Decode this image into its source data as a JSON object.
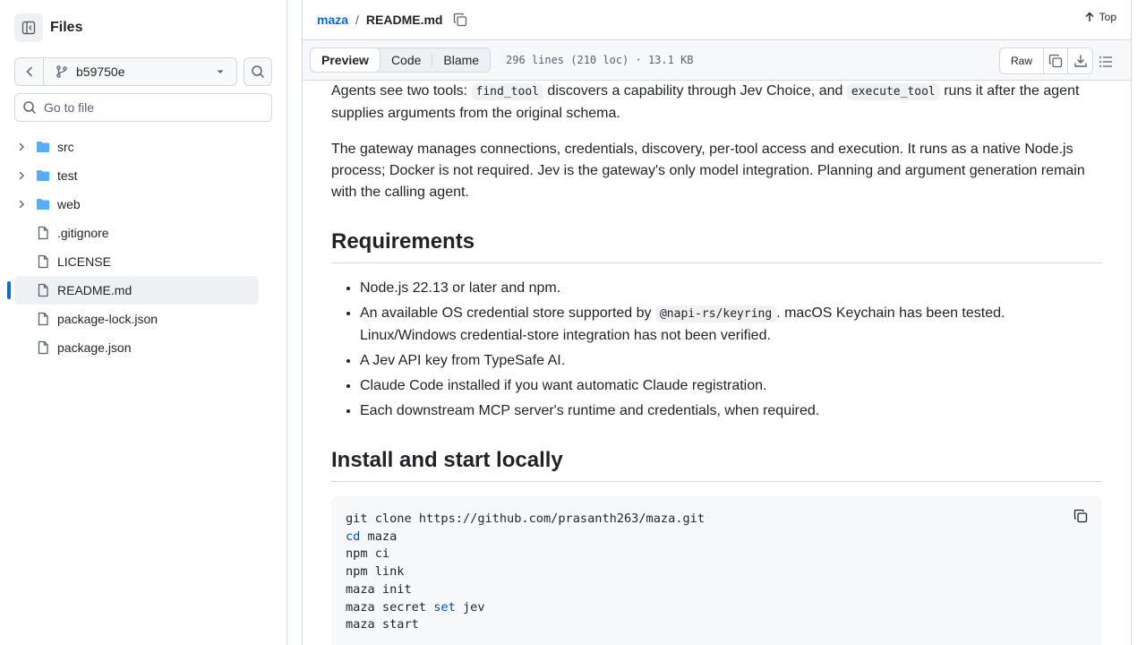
{
  "sidebar": {
    "title": "Files",
    "branch": "b59750e",
    "goto_placeholder": "Go to file",
    "items": [
      {
        "label": "src",
        "type": "folder"
      },
      {
        "label": "test",
        "type": "folder"
      },
      {
        "label": "web",
        "type": "folder"
      },
      {
        "label": ".gitignore",
        "type": "file"
      },
      {
        "label": "LICENSE",
        "type": "file"
      },
      {
        "label": "README.md",
        "type": "file",
        "active": true
      },
      {
        "label": "package-lock.json",
        "type": "file"
      },
      {
        "label": "package.json",
        "type": "file"
      }
    ]
  },
  "header": {
    "repo": "maza",
    "separator": "/",
    "file": "README.md",
    "top_label": "Top"
  },
  "toolbar": {
    "tabs": [
      "Preview",
      "Code",
      "Blame"
    ],
    "file_info": "296 lines (210 loc) · 13.1 KB",
    "raw_label": "Raw"
  },
  "readme": {
    "p1_a": "Agents see two tools: ",
    "p1_code1": "find_tool",
    "p1_b": " discovers a capability through Jev Choice, and ",
    "p1_code2": "execute_tool",
    "p1_c": " runs it after the agent supplies arguments from the original schema.",
    "p2": "The gateway manages connections, credentials, discovery, per-tool access and execution. It runs as a native Node.js process; Docker is not required. Jev is the gateway's only model integration. Planning and argument generation remain with the calling agent.",
    "h_requirements": "Requirements",
    "req1": "Node.js 22.13 or later and npm.",
    "req2_a": "An available OS credential store supported by ",
    "req2_code": "@napi-rs/keyring",
    "req2_b": ". macOS Keychain has been tested. Linux/Windows credential-store integration has not been verified.",
    "req3": "A Jev API key from TypeSafe AI.",
    "req4": "Claude Code installed if you want automatic Claude registration.",
    "req5": "Each downstream MCP server's runtime and credentials, when required.",
    "h_install": "Install and start locally",
    "code": {
      "l1": "git clone https://github.com/prasanth263/maza.git",
      "l2_kw": "cd",
      "l2_rest": " maza",
      "l3": "npm ci",
      "l4": "npm link",
      "l5": "maza init",
      "l6_a": "maza secret ",
      "l6_kw": "set",
      "l6_b": " jev",
      "l7": "maza start"
    }
  },
  "colors": {
    "accent": "#0969da",
    "border": "#d1d9e0",
    "folder": "#54aeff"
  }
}
